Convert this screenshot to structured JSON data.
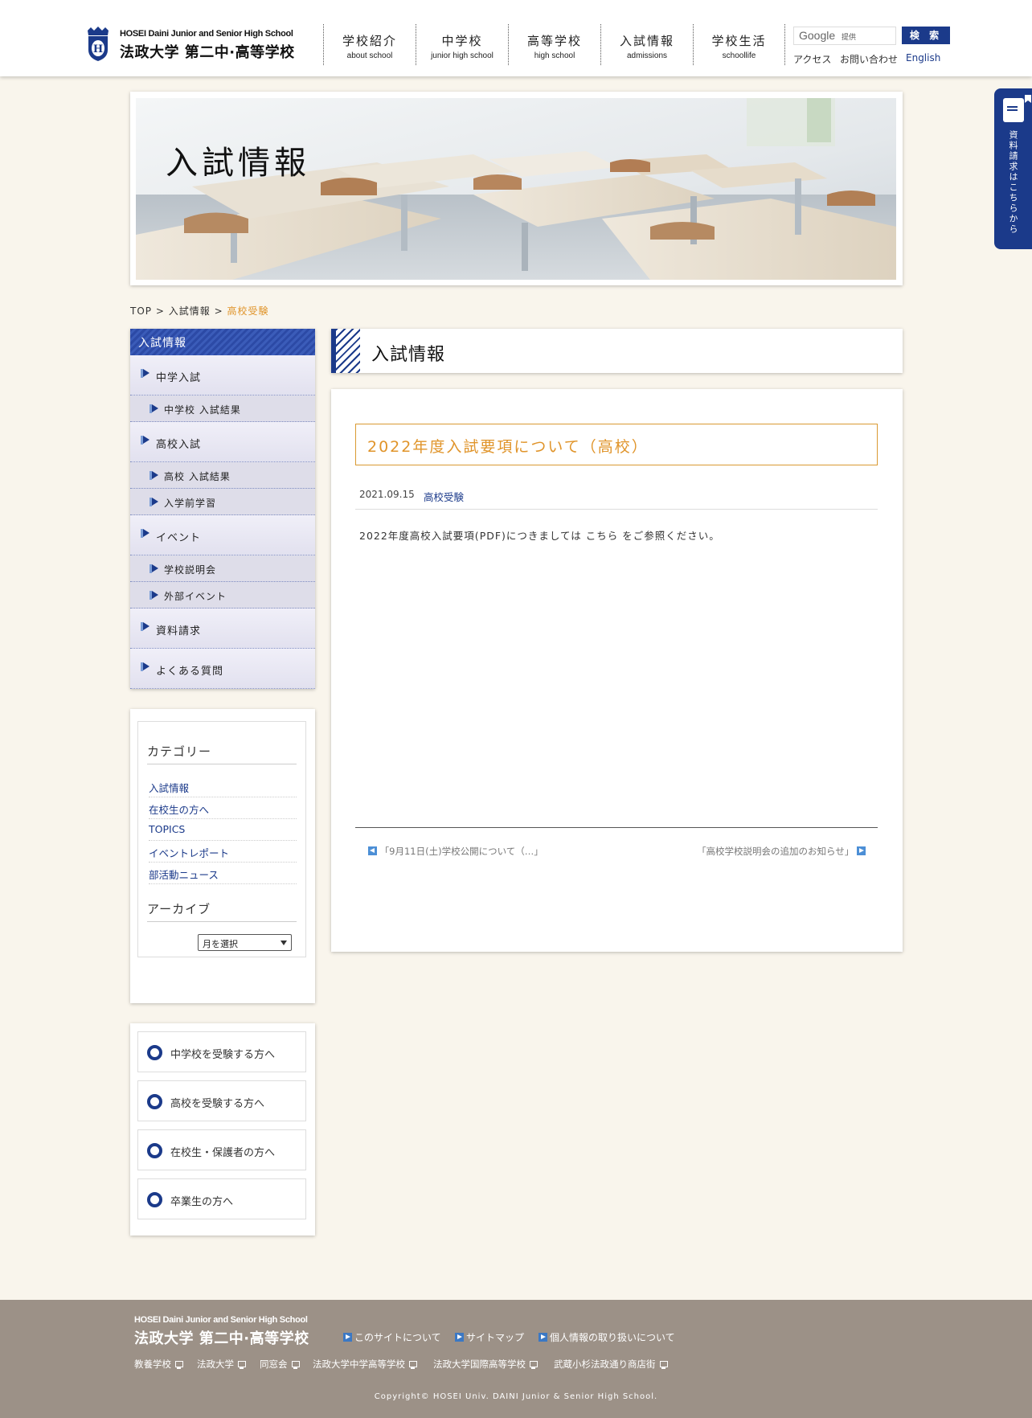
{
  "header": {
    "logo_en": "HOSEI Daini Junior and Senior High School",
    "logo_ja": "法政大学 第二中·高等学校",
    "nav": [
      {
        "jp": "学校紹介",
        "en": "about school"
      },
      {
        "jp": "中学校",
        "en": "junior high school"
      },
      {
        "jp": "高等学校",
        "en": "high school"
      },
      {
        "jp": "入試情報",
        "en": "admissions"
      },
      {
        "jp": "学校生活",
        "en": "schoollife"
      }
    ],
    "search_google": "Google",
    "search_provided": "提供",
    "search_button": "検 索",
    "links": [
      "アクセス",
      "お問い合わせ",
      "English"
    ]
  },
  "request_tab": "資料請求はこちらから",
  "hero_title": "入試情報",
  "breadcrumb": {
    "top": "TOP",
    "sep": ">",
    "parent": "入試情報",
    "current": "高校受験"
  },
  "sidemenu": {
    "header": "入試情報",
    "items": [
      {
        "label": "中学入試",
        "type": "main"
      },
      {
        "label": "中学校 入試結果",
        "type": "sub"
      },
      {
        "label": "高校入試",
        "type": "main"
      },
      {
        "label": "高校 入試結果",
        "type": "sub"
      },
      {
        "label": "入学前学習",
        "type": "sub"
      },
      {
        "label": "イベント",
        "type": "main"
      },
      {
        "label": "学校説明会",
        "type": "sub"
      },
      {
        "label": "外部イベント",
        "type": "sub"
      },
      {
        "label": "資料請求",
        "type": "main"
      },
      {
        "label": "よくある質問",
        "type": "main"
      }
    ]
  },
  "category": {
    "title": "カテゴリー",
    "items": [
      "入試情報",
      "在校生の方へ",
      "TOPICS",
      "イベントレポート",
      "部活動ニュース"
    ],
    "archive_title": "アーカイブ",
    "archive_select": "月を選択"
  },
  "visitor_links": [
    "中学校を受験する方へ",
    "高校を受験する方へ",
    "在校生・保護者の方へ",
    "卒業生の方へ"
  ],
  "section_title": "入試情報",
  "article": {
    "title": "2022年度入試要項について（高校）",
    "date": "2021.09.15",
    "category": "高校受験",
    "body": "2022年度高校入試要項(PDF)につきましては こちら をご参照ください。",
    "prev": "「9月11日(土)学校公開について（…」",
    "next": "「高校学校説明会の追加のお知らせ」"
  },
  "footer": {
    "logo_en": "HOSEI Daini Junior and Senior High School",
    "logo_ja": "法政大学 第二中·高等学校",
    "links": [
      "このサイトについて",
      "サイトマップ",
      "個人情報の取り扱いについて"
    ],
    "sites": [
      "教養学校",
      "法政大学",
      "同窓会",
      "法政大学中学高等学校",
      "法政大学国際高等学校",
      "武蔵小杉法政通り商店街"
    ],
    "copyright": "Copyright© HOSEI Univ. DAINI Junior & Senior High School."
  }
}
